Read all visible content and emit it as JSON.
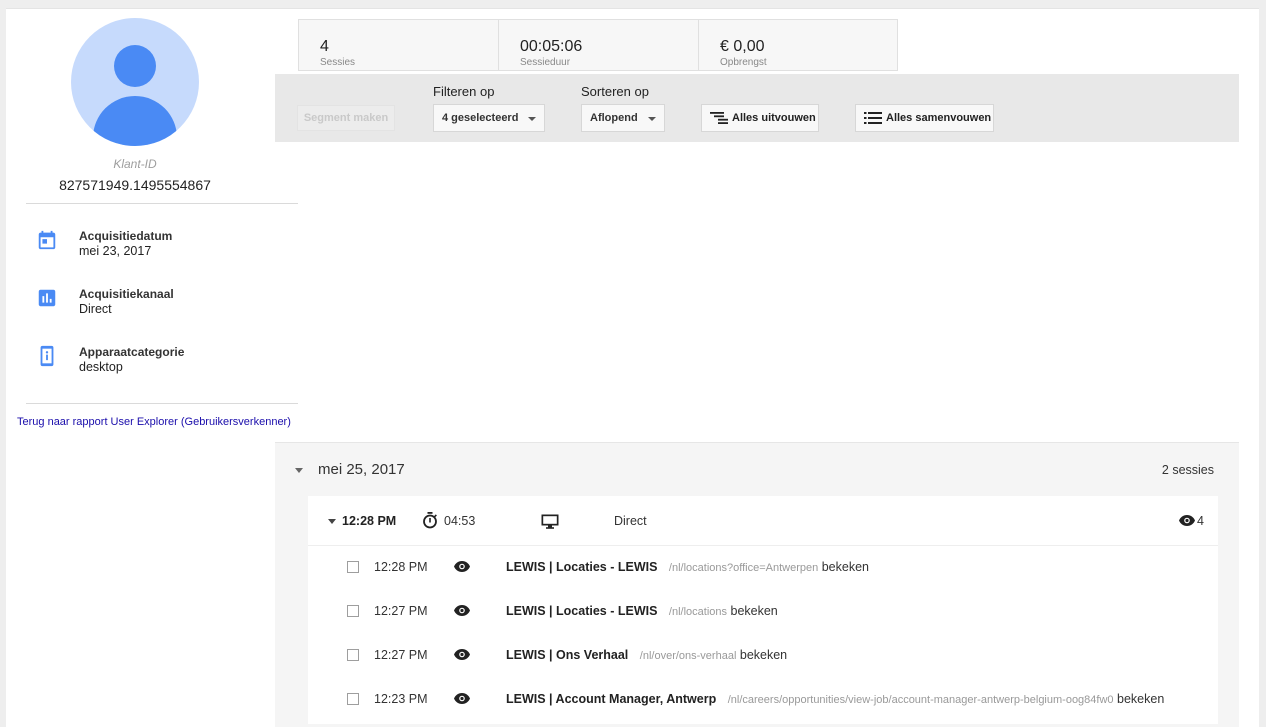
{
  "profile": {
    "client_id_label": "Klant-ID",
    "client_id": "827571949.1495554867",
    "info": [
      {
        "label": "Acquisitiedatum",
        "value": "mei 23, 2017",
        "icon": "calendar-icon"
      },
      {
        "label": "Acquisitiekanaal",
        "value": "Direct",
        "icon": "bar-chart-icon"
      },
      {
        "label": "Apparaatcategorie",
        "value": "desktop",
        "icon": "device-icon"
      }
    ],
    "back_link": "Terug naar rapport User Explorer (Gebruikersverkenner)"
  },
  "metrics": [
    {
      "value": "4",
      "label": "Sessies"
    },
    {
      "value": "00:05:06",
      "label": "Sessieduur"
    },
    {
      "value": "€ 0,00",
      "label": "Opbrengst"
    }
  ],
  "toolbar": {
    "segment_button": "Segment maken",
    "filter_label": "Filteren op",
    "filter_value": "4 geselecteerd",
    "sort_label": "Sorteren op",
    "sort_value": "Aflopend",
    "expand_all": "Alles uitvouwen",
    "collapse_all": "Alles samenvouwen"
  },
  "colors": {
    "accent": "#4a8af4",
    "avatar_bg": "#c6dafc",
    "link": "#1a0dab"
  },
  "day": {
    "date": "mei 25, 2017",
    "count": "2 sessies",
    "session": {
      "time": "12:28 PM",
      "duration": "04:53",
      "channel": "Direct",
      "hit_count": "4",
      "hits": [
        {
          "time": "12:28 PM",
          "title": "LEWIS | Locaties - LEWIS",
          "path": "/nl/locations?office=Antwerpen",
          "action": "bekeken"
        },
        {
          "time": "12:27 PM",
          "title": "LEWIS | Locaties - LEWIS",
          "path": "/nl/locations",
          "action": "bekeken"
        },
        {
          "time": "12:27 PM",
          "title": "LEWIS | Ons Verhaal",
          "path": "/nl/over/ons-verhaal",
          "action": "bekeken"
        },
        {
          "time": "12:23 PM",
          "title": "LEWIS | Account Manager, Antwerp",
          "path": "/nl/careers/opportunities/view-job/account-manager-antwerp-belgium-oog84fw0",
          "action": "bekeken"
        }
      ]
    }
  }
}
